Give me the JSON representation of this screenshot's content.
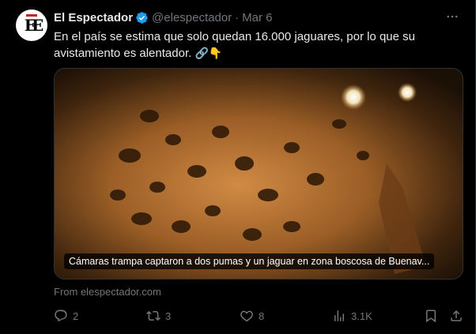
{
  "author": {
    "name": "El Espectador",
    "handle": "@elespectador",
    "separator": "·",
    "date": "Mar 6",
    "avatar_letters": "EE"
  },
  "tweet_text": "En el país se estima que solo quedan 16.000 jaguares, por lo que su avistamiento es alentador.",
  "tweet_emojis": "🔗👇",
  "media": {
    "caption": "Cámaras trampa captaron a dos pumas y un jaguar en zona boscosa de Buenav..."
  },
  "source": "From elespectador.com",
  "actions": {
    "replies": "2",
    "retweets": "3",
    "likes": "8",
    "views": "3.1K"
  },
  "colors": {
    "background": "#000000",
    "text": "#e7e9ea",
    "muted": "#71767b",
    "verified": "#1d9bf0",
    "logo_accent": "#c3212e"
  },
  "icons": [
    "verified-badge-icon",
    "more-icon",
    "reply-icon",
    "retweet-icon",
    "like-icon",
    "views-icon",
    "bookmark-icon",
    "share-icon"
  ]
}
